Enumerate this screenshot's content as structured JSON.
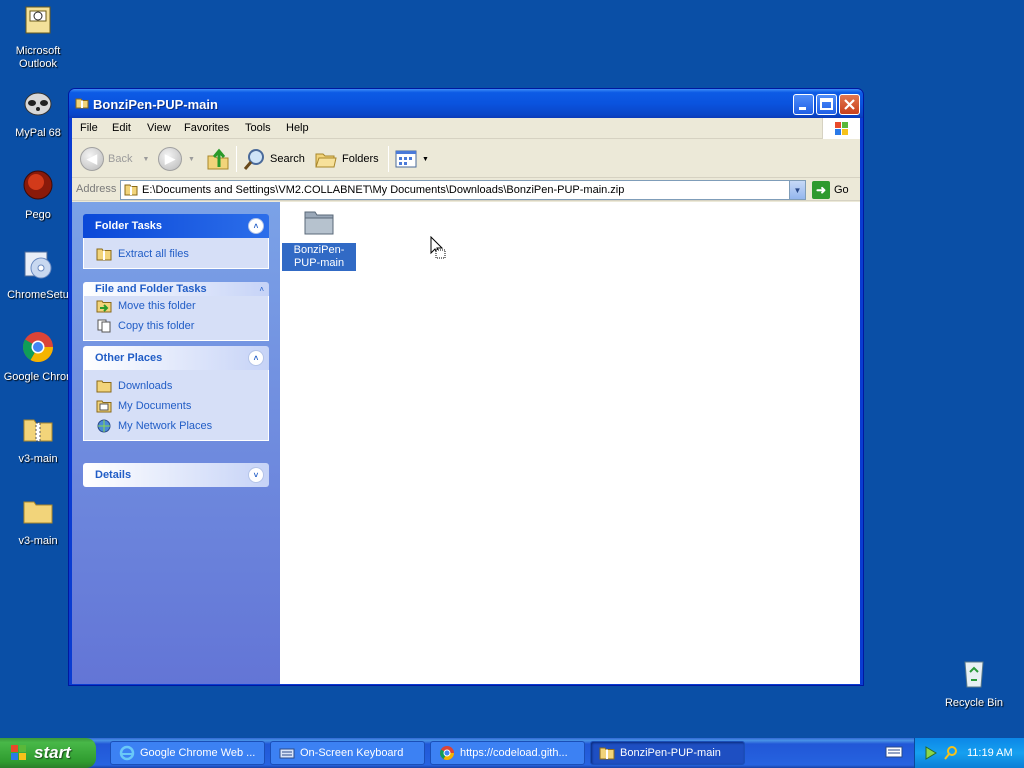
{
  "desktop": {
    "icons": [
      {
        "label_line1": "Microsoft",
        "label_line2": "Outlook",
        "icon": "outlook-icon"
      },
      {
        "label_line1": "MyPal 68",
        "label_line2": "",
        "icon": "raccoon-icon"
      },
      {
        "label_line1": "Pego",
        "label_line2": "",
        "icon": "pego-icon"
      },
      {
        "label_line1": "ChromeSetu",
        "label_line2": "",
        "icon": "installer-cd-icon"
      },
      {
        "label_line1": "Google Chron",
        "label_line2": "",
        "icon": "chrome-icon"
      },
      {
        "label_line1": "v3-main",
        "label_line2": "",
        "icon": "zip-folder-icon"
      },
      {
        "label_line1": "v3-main",
        "label_line2": "",
        "icon": "folder-icon"
      }
    ],
    "recycle_bin": "Recycle Bin"
  },
  "window": {
    "title": "BonziPen-PUP-main",
    "menu": [
      "File",
      "Edit",
      "View",
      "Favorites",
      "Tools",
      "Help"
    ],
    "toolbar": {
      "back": "Back",
      "search": "Search",
      "folders": "Folders"
    },
    "address": {
      "label": "Address",
      "value": "E:\\Documents and Settings\\VM2.COLLABNET\\My Documents\\Downloads\\BonziPen-PUP-main.zip",
      "go": "Go"
    },
    "taskpane": {
      "folder_tasks": {
        "title": "Folder Tasks",
        "items": [
          "Extract all files"
        ]
      },
      "file_folder_tasks": {
        "title": "File and Folder Tasks",
        "items": [
          "Move this folder",
          "Copy this folder"
        ]
      },
      "other_places": {
        "title": "Other Places",
        "items": [
          "Downloads",
          "My Documents",
          "My Network Places"
        ]
      },
      "details": {
        "title": "Details"
      }
    },
    "files": [
      {
        "name": "BonziPen-PUP-main",
        "selected": true
      }
    ]
  },
  "taskbar": {
    "start": "start",
    "tasks": [
      {
        "label": "Google Chrome Web ...",
        "icon": "ie-icon"
      },
      {
        "label": "On-Screen Keyboard",
        "icon": "keyboard-icon"
      },
      {
        "label": "https://codeload.gith...",
        "icon": "chrome-icon"
      },
      {
        "label": "BonziPen-PUP-main",
        "icon": "zip-folder-icon",
        "active": true
      }
    ],
    "clock": "11:19 AM"
  }
}
